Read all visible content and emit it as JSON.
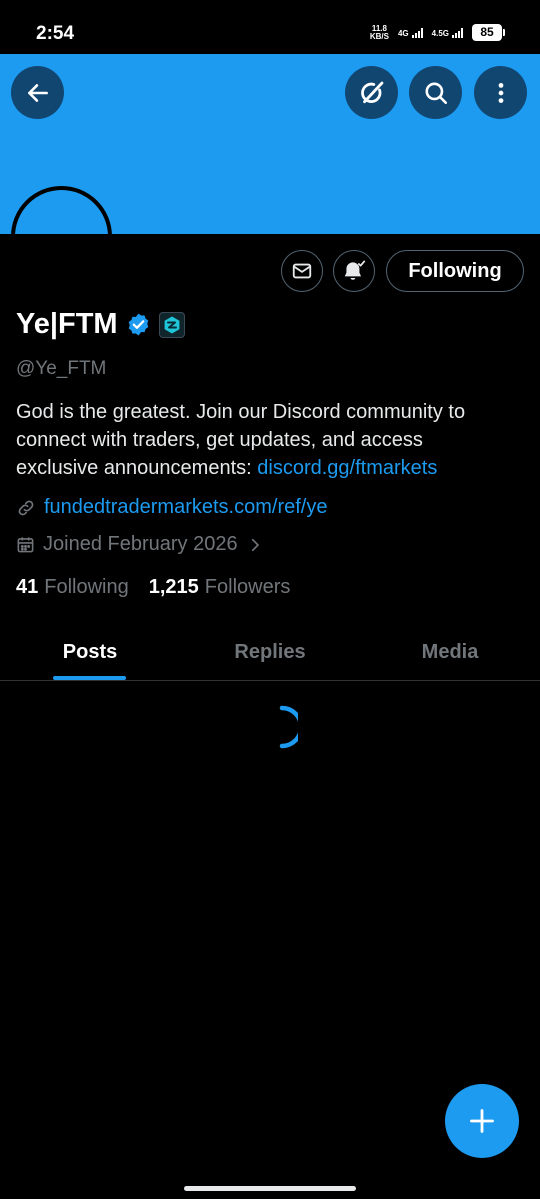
{
  "status_bar": {
    "time": "2:54",
    "net_speed_value": "11.8",
    "net_speed_unit": "KB/S",
    "signal1_label": "4G",
    "signal2_label": "4.5G",
    "battery": "85"
  },
  "banner": {
    "color": "#1d9bf0"
  },
  "header_buttons": {
    "back_icon": "arrow-left-icon",
    "grok_icon": "grok-icon",
    "search_icon": "search-icon",
    "more_icon": "more-vertical-icon"
  },
  "actions": {
    "message_icon": "envelope-icon",
    "notify_icon": "bell-check-icon",
    "follow_label": "Following"
  },
  "profile": {
    "display_name": "Ye|FTM",
    "verified_icon": "verified-badge-icon",
    "affiliate_icon": "affiliate-badge-icon",
    "handle": "@Ye_FTM",
    "bio_text": "God is the greatest. Join our Discord community to connect with traders, get updates, and access exclusive announcements: ",
    "bio_link": "discord.gg/ftmarkets",
    "website": "fundedtradermarkets.com/ref/ye",
    "joined": "Joined February 2026",
    "following_count": "41",
    "following_label": "Following",
    "followers_count": "1,215",
    "followers_label": "Followers"
  },
  "tabs": [
    {
      "label": "Posts",
      "active": true
    },
    {
      "label": "Replies",
      "active": false
    },
    {
      "label": "Media",
      "active": false
    }
  ],
  "fab_icon": "plus-icon",
  "colors": {
    "accent": "#1d9bf0",
    "muted": "#71767b",
    "background": "#000000"
  }
}
